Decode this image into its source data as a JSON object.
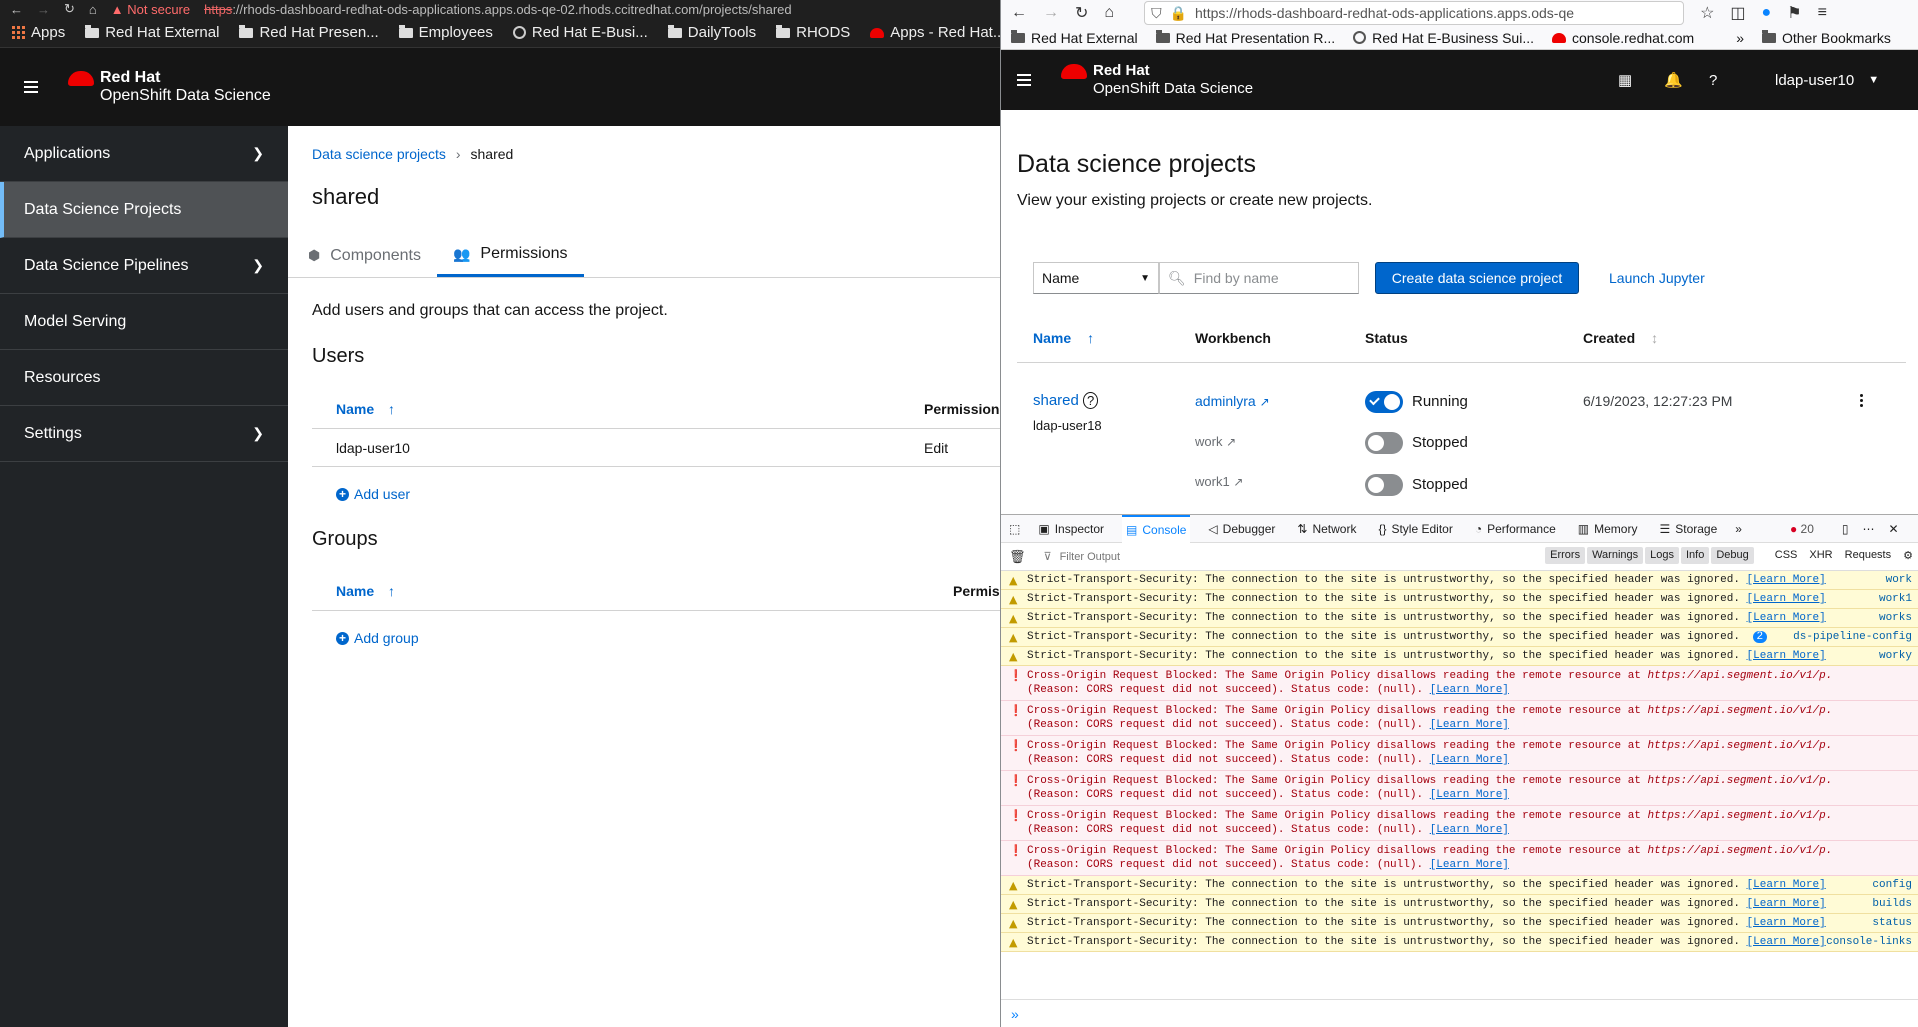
{
  "left": {
    "browser": {
      "not_secure": "Not secure",
      "url": "rhods-dashboard-redhat-ods-applications.apps.ods-qe-02.rhods.ccitredhat.com/projects/shared",
      "url_scheme": "https"
    },
    "bookmarks": [
      "Apps",
      "Red Hat External",
      "Red Hat Presen...",
      "Employees",
      "Red Hat E-Busi...",
      "DailyTools",
      "RHODS",
      "Apps - Red Hat..."
    ],
    "brand": {
      "line1": "Red Hat",
      "line2": "OpenShift Data Science"
    },
    "nav": [
      {
        "label": "Applications",
        "chevron": true
      },
      {
        "label": "Data Science Projects",
        "active": true
      },
      {
        "label": "Data Science Pipelines",
        "chevron": true
      },
      {
        "label": "Model Serving"
      },
      {
        "label": "Resources"
      },
      {
        "label": "Settings",
        "chevron": true
      }
    ],
    "breadcrumb": {
      "parent": "Data science projects",
      "sep": "›",
      "current": "shared"
    },
    "title": "shared",
    "tabs": [
      "Components",
      "Permissions"
    ],
    "description": "Add users and groups that can access the project.",
    "users": {
      "heading": "Users",
      "col_name": "Name",
      "col_perm": "Permission",
      "rows": [
        {
          "name": "ldap-user10",
          "perm": "Edit"
        }
      ],
      "add": "Add user"
    },
    "groups": {
      "heading": "Groups",
      "col_name": "Name",
      "col_perm": "Permiss",
      "add": "Add group"
    }
  },
  "right": {
    "browser": {
      "url": "https://rhods-dashboard-redhat-ods-applications.apps.ods-qe"
    },
    "bookmarks": [
      "Red Hat External",
      "Red Hat Presentation R...",
      "Red Hat E-Business Sui...",
      "console.redhat.com",
      "Other Bookmarks"
    ],
    "brand": {
      "line1": "Red Hat",
      "line2": "OpenShift Data Science"
    },
    "user": "ldap-user10",
    "page_title": "Data science projects",
    "page_desc": "View your existing projects or create new projects.",
    "filter": {
      "select": "Name",
      "placeholder": "Find by name"
    },
    "create_btn": "Create data science project",
    "launch": "Launch Jupyter",
    "cols": {
      "name": "Name",
      "workbench": "Workbench",
      "status": "Status",
      "created": "Created"
    },
    "project": {
      "name": "shared",
      "owner": "ldap-user18",
      "created": "6/19/2023, 12:27:23 PM",
      "workbenches": [
        {
          "name": "adminlyra",
          "status": "Running",
          "on": true
        },
        {
          "name": "work",
          "status": "Stopped",
          "on": false
        },
        {
          "name": "work1",
          "status": "Stopped",
          "on": false
        }
      ]
    },
    "devtools": {
      "tabs": [
        "Inspector",
        "Console",
        "Debugger",
        "Network",
        "Style Editor",
        "Performance",
        "Memory",
        "Storage"
      ],
      "error_count": "20",
      "filter_placeholder": "Filter Output",
      "levels": [
        "Errors",
        "Warnings",
        "Logs",
        "Info",
        "Debug"
      ],
      "extra": [
        "CSS",
        "XHR",
        "Requests"
      ],
      "learn": "[Learn More]",
      "sts_msg": "Strict-Transport-Security: The connection to the site is untrustworthy, so the specified header was ignored.",
      "cors_msg1": "Cross-Origin Request Blocked: The Same Origin Policy disallows reading the remote resource at",
      "cors_url": "https://api.segment.io/v1/p.",
      "cors_msg2": "(Reason: CORS request did not succeed). Status code: (null).",
      "prompt": "»",
      "badge": "2",
      "lines": [
        {
          "t": "w",
          "src": "work"
        },
        {
          "t": "w",
          "src": "work1"
        },
        {
          "t": "w",
          "src": "works"
        },
        {
          "t": "w",
          "src": "ds-pipeline-config",
          "badge": true
        },
        {
          "t": "w",
          "src": "worky"
        },
        {
          "t": "e"
        },
        {
          "t": "e"
        },
        {
          "t": "e"
        },
        {
          "t": "e"
        },
        {
          "t": "e"
        },
        {
          "t": "e"
        },
        {
          "t": "w",
          "src": "config"
        },
        {
          "t": "w",
          "src": "builds"
        },
        {
          "t": "w",
          "src": "status"
        },
        {
          "t": "w",
          "src": "console-links"
        }
      ]
    }
  }
}
